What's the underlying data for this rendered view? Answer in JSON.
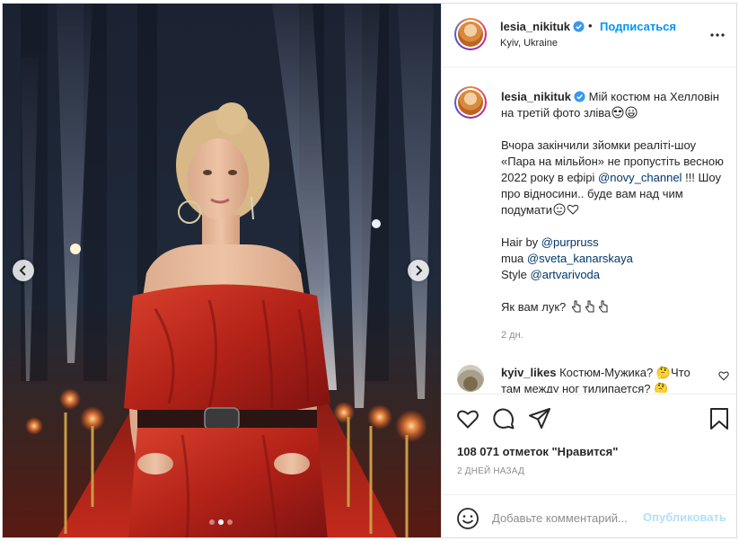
{
  "post": {
    "username": "lesia_nikituk",
    "separator": "•",
    "follow_label": "Подписаться",
    "location": "Kyiv, Ukraine"
  },
  "caption": {
    "line1_text": "Мій костюм на Хелловін на третій фото зліва",
    "para2_text": "Вчора закінчили зйомки реаліті-шоу «Пара на мільйон» не пропустіть весною 2022 року в ефірі",
    "para2_mention": "@novy_channel",
    "para2_tail": " !!! Шоу про відносини.. буде вам над чим подумати",
    "hair_label": "Hair by ",
    "hair_mention": "@purpruss",
    "mua_label": "mua ",
    "mua_mention": "@sveta_kanarskaya",
    "style_label": "Style ",
    "style_mention": "@artvarivoda",
    "question": "Як вам лук? ",
    "time": "2 дн."
  },
  "comment": {
    "username": "kyiv_likes",
    "text": "Костюм-Мужика? 🤔Что там между ног тилипается? 🤔"
  },
  "likes_text": "108 071 отметок \"Нравится\"",
  "date_text": "2 ДНЕЙ НАЗАД",
  "comment_input": {
    "placeholder": "Добавьте комментарий...",
    "post_label": "Опубликовать"
  },
  "carousel": {
    "slides": 3,
    "active_index": 1
  },
  "icons": {
    "verified": "verified-badge-icon",
    "more": "more-options-icon",
    "heart": "heart-icon",
    "comment": "comment-icon",
    "share": "share-icon",
    "save": "bookmark-icon",
    "emoji": "emoji-icon",
    "prev": "chevron-left-icon",
    "next": "chevron-right-icon"
  },
  "colors": {
    "link": "#0095f6",
    "mention": "#00376b",
    "muted": "#8e8e8e",
    "post_disabled": "#b2dffc",
    "border": "#dbdbdb"
  }
}
